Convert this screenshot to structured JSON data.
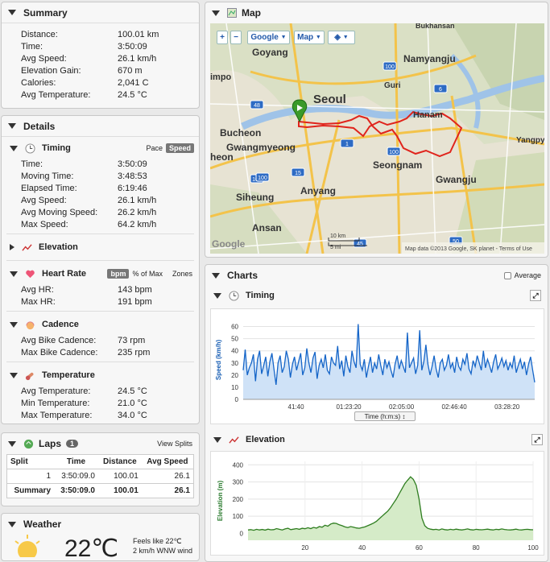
{
  "summary": {
    "title": "Summary",
    "rows": [
      {
        "label": "Distance:",
        "value": "100.01 km"
      },
      {
        "label": "Time:",
        "value": "3:50:09"
      },
      {
        "label": "Avg Speed:",
        "value": "26.1 km/h"
      },
      {
        "label": "Elevation Gain:",
        "value": "670 m"
      },
      {
        "label": "Calories:",
        "value": "2,041 C"
      },
      {
        "label": "Avg Temperature:",
        "value": "24.5 °C"
      }
    ]
  },
  "details": {
    "title": "Details",
    "timing": {
      "title": "Timing",
      "pace": "Pace",
      "speed": "Speed",
      "rows": [
        {
          "label": "Time:",
          "value": "3:50:09"
        },
        {
          "label": "Moving Time:",
          "value": "3:48:53"
        },
        {
          "label": "Elapsed Time:",
          "value": "6:19:46"
        },
        {
          "label": "Avg Speed:",
          "value": "26.1 km/h"
        },
        {
          "label": "Avg Moving Speed:",
          "value": "26.2 km/h"
        },
        {
          "label": "Max Speed:",
          "value": "64.2 km/h"
        }
      ]
    },
    "elevation": {
      "title": "Elevation"
    },
    "heart": {
      "title": "Heart Rate",
      "bpm": "bpm",
      "pct": "% of Max",
      "zones": "Zones",
      "rows": [
        {
          "label": "Avg HR:",
          "value": "143 bpm"
        },
        {
          "label": "Max HR:",
          "value": "191 bpm"
        }
      ]
    },
    "cadence": {
      "title": "Cadence",
      "rows": [
        {
          "label": "Avg Bike Cadence:",
          "value": "73 rpm"
        },
        {
          "label": "Max Bike Cadence:",
          "value": "235 rpm"
        }
      ]
    },
    "temperature": {
      "title": "Temperature",
      "rows": [
        {
          "label": "Avg Temperature:",
          "value": "24.5 °C"
        },
        {
          "label": "Min Temperature:",
          "value": "21.0 °C"
        },
        {
          "label": "Max Temperature:",
          "value": "34.0 °C"
        }
      ]
    }
  },
  "laps": {
    "title": "Laps",
    "count": "1",
    "view": "View Splits",
    "headers": [
      "Split",
      "Time",
      "Distance",
      "Avg Speed"
    ],
    "rows": [
      [
        "1",
        "3:50:09.0",
        "100.01",
        "26.1"
      ],
      [
        "Summary",
        "3:50:09.0",
        "100.01",
        "26.1"
      ]
    ]
  },
  "weather": {
    "title": "Weather",
    "temp": "22℃",
    "feels": "Feels like 22℃",
    "wind": "2 km/h WNW wind"
  },
  "map": {
    "title": "Map",
    "google": "Google",
    "maptype": "Map",
    "attribution": "Map data ©2013 Google, SK planet - Terms of Use",
    "scale_km": "10 km",
    "scale_mi": "5 mi",
    "logo": "Google",
    "labels": [
      "Bukhansan",
      "Goyang",
      "Namyangju",
      "Guri",
      "Seoul",
      "Hanam",
      "Bucheon",
      "Gwangmyeong",
      "Seongnam",
      "Gwangju",
      "Yangpy",
      "Siheung",
      "Anyang",
      "Ansan",
      "impo",
      "heon"
    ],
    "shields": [
      "100",
      "6",
      "48",
      "1",
      "100",
      "100",
      "100",
      "15",
      "50",
      "100",
      "45"
    ]
  },
  "charts": {
    "title": "Charts",
    "average": "Average",
    "timing": {
      "title": "Timing",
      "selector": "Time (h:m:s)"
    },
    "elevation": {
      "title": "Elevation"
    }
  },
  "chart_data": [
    {
      "type": "line",
      "title": "Timing",
      "ylabel": "Speed (km/h)",
      "xlabel": "Time (h:m:s)",
      "ylim": [
        0,
        65
      ],
      "yticks": [
        0,
        10,
        20,
        30,
        40,
        50,
        60
      ],
      "xticks": [
        "41:40",
        "01:23:20",
        "02:05:00",
        "02:46:40",
        "03:28:20"
      ],
      "xtick_seconds": [
        2500,
        5000,
        7500,
        10000,
        12500
      ],
      "xlim": [
        0,
        13810
      ],
      "series": [
        {
          "values": [
            24,
            41,
            20,
            26,
            30,
            37,
            15,
            33,
            40,
            21,
            28,
            35,
            19,
            31,
            38,
            25,
            12,
            30,
            36,
            22,
            27,
            40,
            33,
            18,
            29,
            35,
            24,
            31,
            38,
            20,
            26,
            42,
            30,
            22,
            34,
            39,
            17,
            28,
            33,
            26,
            37,
            24,
            21,
            35,
            30,
            28,
            44,
            25,
            32,
            19,
            36,
            27,
            22,
            40,
            31,
            26,
            62,
            29,
            24,
            33,
            18,
            27,
            35,
            22,
            30,
            25,
            37,
            28,
            20,
            33,
            26,
            31,
            24,
            18,
            29,
            36,
            25,
            32,
            27,
            22,
            55,
            26,
            30,
            34,
            21,
            28,
            57,
            24,
            31,
            45,
            29,
            20,
            27,
            36,
            25,
            18,
            30,
            33,
            24,
            28,
            37,
            26,
            30,
            22,
            35,
            27,
            24,
            33,
            29,
            38,
            25,
            21,
            32,
            27,
            36,
            30,
            24,
            40,
            26,
            33,
            28,
            22,
            31,
            37,
            25,
            29,
            34,
            27,
            32,
            24,
            30,
            26,
            36,
            22,
            28,
            33,
            25,
            31,
            20,
            29,
            35,
            24,
            14
          ]
        }
      ]
    },
    {
      "type": "area",
      "title": "Elevation",
      "ylabel": "Elevation (m)",
      "ylim": [
        -40,
        420
      ],
      "yticks": [
        0,
        100,
        200,
        300,
        400
      ],
      "xticks": [
        20,
        40,
        60,
        80,
        100
      ],
      "xlim": [
        0,
        100
      ],
      "series": [
        {
          "values": [
            20,
            22,
            18,
            24,
            20,
            23,
            19,
            25,
            21,
            22,
            28,
            24,
            20,
            26,
            30,
            22,
            25,
            28,
            24,
            30,
            27,
            33,
            28,
            35,
            31,
            40,
            36,
            48,
            42,
            55,
            60,
            58,
            50,
            45,
            38,
            34,
            40,
            36,
            32,
            30,
            34,
            38,
            45,
            52,
            60,
            70,
            85,
            100,
            115,
            130,
            150,
            175,
            200,
            230,
            260,
            290,
            310,
            330,
            315,
            280,
            200,
            90,
            45,
            30,
            25,
            22,
            24,
            20,
            26,
            22,
            20,
            24,
            21,
            25,
            22,
            20,
            23,
            26,
            22,
            20,
            24,
            22,
            21,
            23,
            25,
            22,
            20,
            24,
            22,
            26,
            23,
            21,
            20,
            22,
            25,
            21,
            20,
            23,
            24,
            22,
            21
          ]
        }
      ]
    }
  ]
}
